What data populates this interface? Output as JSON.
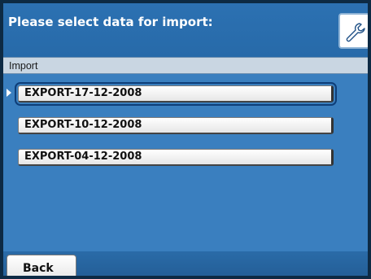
{
  "header": {
    "title": "Please select data for import:",
    "settings_icon": "wrench-icon"
  },
  "section": {
    "label": "Import"
  },
  "items": [
    {
      "label": "EXPORT-17-12-2008",
      "selected": true
    },
    {
      "label": "EXPORT-10-12-2008",
      "selected": false
    },
    {
      "label": "EXPORT-04-12-2008",
      "selected": false
    }
  ],
  "footer": {
    "back_label": "Back"
  },
  "colors": {
    "background": "#3a7fbf",
    "header": "#2c71b2",
    "section_bar": "#c9d6e2",
    "selection_outline": "#0e3e78"
  }
}
